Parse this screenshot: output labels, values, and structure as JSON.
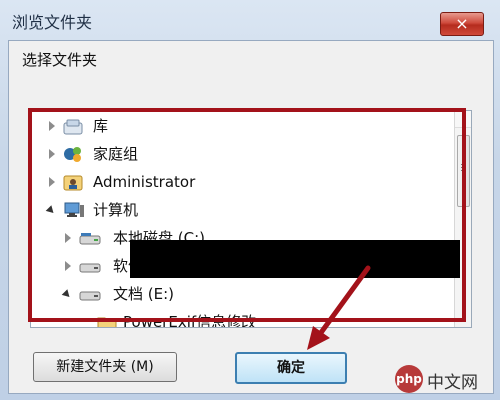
{
  "window": {
    "title": "浏览文件夹",
    "close_label": "×"
  },
  "dialog": {
    "instruction": "选择文件夹"
  },
  "tree": {
    "items": [
      {
        "label": "库",
        "expanded": false
      },
      {
        "label": "家庭组",
        "expanded": false
      },
      {
        "label": "Administrator",
        "expanded": false
      },
      {
        "label": "计算机",
        "expanded": true
      },
      {
        "label": "本地磁盘 (C:)",
        "expanded": false
      },
      {
        "label": "软件 (D:)",
        "expanded": false
      },
      {
        "label": "文档 (E:)",
        "expanded": true
      },
      {
        "label": "PowerExif信息修改",
        "expanded": false
      }
    ]
  },
  "buttons": {
    "new_folder": "新建文件夹 (M)",
    "ok": "确定"
  },
  "watermark": {
    "logo": "php",
    "text": "中文网"
  },
  "colors": {
    "highlight": "#a3121a",
    "arrow": "#a3121a"
  }
}
